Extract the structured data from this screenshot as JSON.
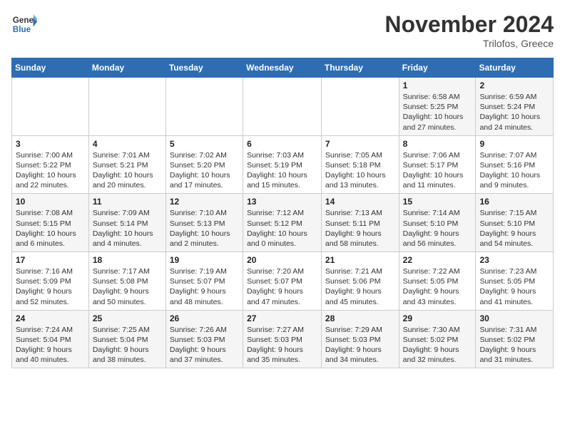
{
  "header": {
    "logo_line1": "General",
    "logo_line2": "Blue",
    "month": "November 2024",
    "location": "Trilofos, Greece"
  },
  "weekdays": [
    "Sunday",
    "Monday",
    "Tuesday",
    "Wednesday",
    "Thursday",
    "Friday",
    "Saturday"
  ],
  "weeks": [
    [
      {
        "day": "",
        "info": ""
      },
      {
        "day": "",
        "info": ""
      },
      {
        "day": "",
        "info": ""
      },
      {
        "day": "",
        "info": ""
      },
      {
        "day": "",
        "info": ""
      },
      {
        "day": "1",
        "info": "Sunrise: 6:58 AM\nSunset: 5:25 PM\nDaylight: 10 hours and 27 minutes."
      },
      {
        "day": "2",
        "info": "Sunrise: 6:59 AM\nSunset: 5:24 PM\nDaylight: 10 hours and 24 minutes."
      }
    ],
    [
      {
        "day": "3",
        "info": "Sunrise: 7:00 AM\nSunset: 5:22 PM\nDaylight: 10 hours and 22 minutes."
      },
      {
        "day": "4",
        "info": "Sunrise: 7:01 AM\nSunset: 5:21 PM\nDaylight: 10 hours and 20 minutes."
      },
      {
        "day": "5",
        "info": "Sunrise: 7:02 AM\nSunset: 5:20 PM\nDaylight: 10 hours and 17 minutes."
      },
      {
        "day": "6",
        "info": "Sunrise: 7:03 AM\nSunset: 5:19 PM\nDaylight: 10 hours and 15 minutes."
      },
      {
        "day": "7",
        "info": "Sunrise: 7:05 AM\nSunset: 5:18 PM\nDaylight: 10 hours and 13 minutes."
      },
      {
        "day": "8",
        "info": "Sunrise: 7:06 AM\nSunset: 5:17 PM\nDaylight: 10 hours and 11 minutes."
      },
      {
        "day": "9",
        "info": "Sunrise: 7:07 AM\nSunset: 5:16 PM\nDaylight: 10 hours and 9 minutes."
      }
    ],
    [
      {
        "day": "10",
        "info": "Sunrise: 7:08 AM\nSunset: 5:15 PM\nDaylight: 10 hours and 6 minutes."
      },
      {
        "day": "11",
        "info": "Sunrise: 7:09 AM\nSunset: 5:14 PM\nDaylight: 10 hours and 4 minutes."
      },
      {
        "day": "12",
        "info": "Sunrise: 7:10 AM\nSunset: 5:13 PM\nDaylight: 10 hours and 2 minutes."
      },
      {
        "day": "13",
        "info": "Sunrise: 7:12 AM\nSunset: 5:12 PM\nDaylight: 10 hours and 0 minutes."
      },
      {
        "day": "14",
        "info": "Sunrise: 7:13 AM\nSunset: 5:11 PM\nDaylight: 9 hours and 58 minutes."
      },
      {
        "day": "15",
        "info": "Sunrise: 7:14 AM\nSunset: 5:10 PM\nDaylight: 9 hours and 56 minutes."
      },
      {
        "day": "16",
        "info": "Sunrise: 7:15 AM\nSunset: 5:10 PM\nDaylight: 9 hours and 54 minutes."
      }
    ],
    [
      {
        "day": "17",
        "info": "Sunrise: 7:16 AM\nSunset: 5:09 PM\nDaylight: 9 hours and 52 minutes."
      },
      {
        "day": "18",
        "info": "Sunrise: 7:17 AM\nSunset: 5:08 PM\nDaylight: 9 hours and 50 minutes."
      },
      {
        "day": "19",
        "info": "Sunrise: 7:19 AM\nSunset: 5:07 PM\nDaylight: 9 hours and 48 minutes."
      },
      {
        "day": "20",
        "info": "Sunrise: 7:20 AM\nSunset: 5:07 PM\nDaylight: 9 hours and 47 minutes."
      },
      {
        "day": "21",
        "info": "Sunrise: 7:21 AM\nSunset: 5:06 PM\nDaylight: 9 hours and 45 minutes."
      },
      {
        "day": "22",
        "info": "Sunrise: 7:22 AM\nSunset: 5:05 PM\nDaylight: 9 hours and 43 minutes."
      },
      {
        "day": "23",
        "info": "Sunrise: 7:23 AM\nSunset: 5:05 PM\nDaylight: 9 hours and 41 minutes."
      }
    ],
    [
      {
        "day": "24",
        "info": "Sunrise: 7:24 AM\nSunset: 5:04 PM\nDaylight: 9 hours and 40 minutes."
      },
      {
        "day": "25",
        "info": "Sunrise: 7:25 AM\nSunset: 5:04 PM\nDaylight: 9 hours and 38 minutes."
      },
      {
        "day": "26",
        "info": "Sunrise: 7:26 AM\nSunset: 5:03 PM\nDaylight: 9 hours and 37 minutes."
      },
      {
        "day": "27",
        "info": "Sunrise: 7:27 AM\nSunset: 5:03 PM\nDaylight: 9 hours and 35 minutes."
      },
      {
        "day": "28",
        "info": "Sunrise: 7:29 AM\nSunset: 5:03 PM\nDaylight: 9 hours and 34 minutes."
      },
      {
        "day": "29",
        "info": "Sunrise: 7:30 AM\nSunset: 5:02 PM\nDaylight: 9 hours and 32 minutes."
      },
      {
        "day": "30",
        "info": "Sunrise: 7:31 AM\nSunset: 5:02 PM\nDaylight: 9 hours and 31 minutes."
      }
    ]
  ]
}
